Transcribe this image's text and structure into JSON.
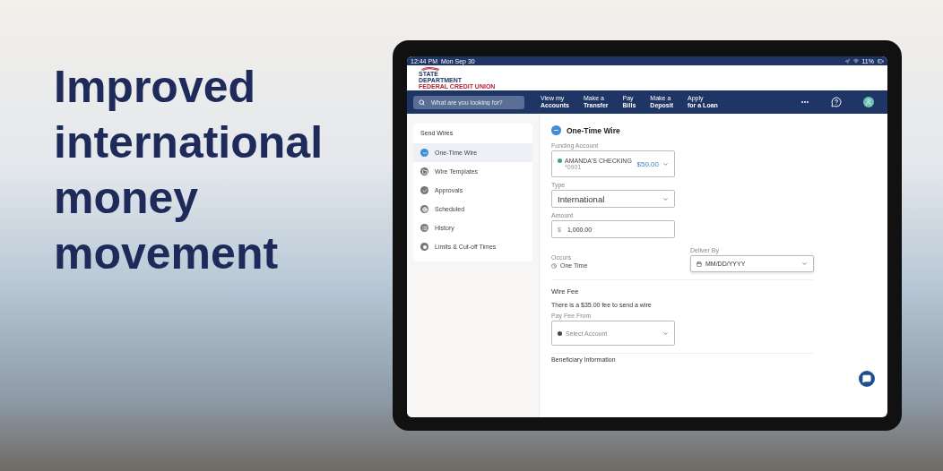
{
  "headline": [
    "Improved",
    "international",
    "money",
    "movement"
  ],
  "status_bar": {
    "time": "12:44 PM",
    "date": "Mon Sep 30",
    "battery": "11%"
  },
  "logo": {
    "lines": [
      "STATE",
      "DEPARTMENT",
      "FEDERAL CREDIT UNION"
    ]
  },
  "search": {
    "placeholder": "What are you looking for?"
  },
  "nav": [
    {
      "top": "View my",
      "bottom": "Accounts"
    },
    {
      "top": "Make a",
      "bottom": "Transfer"
    },
    {
      "top": "Pay",
      "bottom": "Bills"
    },
    {
      "top": "Make a",
      "bottom": "Deposit"
    },
    {
      "top": "Apply",
      "bottom": "for a Loan"
    }
  ],
  "sidebar": {
    "title": "Send Wires",
    "items": [
      {
        "label": "One-Time Wire",
        "selected": true,
        "kind": "minus"
      },
      {
        "label": "Wire Templates",
        "selected": false,
        "kind": "folder"
      },
      {
        "label": "Approvals",
        "selected": false,
        "kind": "check"
      },
      {
        "label": "Scheduled",
        "selected": false,
        "kind": "target"
      },
      {
        "label": "History",
        "selected": false,
        "kind": "list"
      },
      {
        "label": "Limits & Cut-off Times",
        "selected": false,
        "kind": "ring"
      }
    ]
  },
  "form": {
    "title": "One-Time Wire",
    "funding": {
      "label": "Funding Account",
      "name": "AMANDA'S CHECKING",
      "number": "*0901",
      "balance": "$50.00"
    },
    "type": {
      "label": "Type",
      "value": "International"
    },
    "amount": {
      "label": "Amount",
      "currency": "$",
      "value": "1,000.00"
    },
    "occurs": {
      "label": "Occurs",
      "value": "One Time"
    },
    "deliver_by": {
      "label": "Deliver By",
      "placeholder": "MM/DD/YYYY"
    },
    "wire_fee": {
      "heading": "Wire Fee",
      "text": "There is a $35.00 fee to send a wire",
      "label": "Pay Fee From",
      "placeholder": "Select Account"
    },
    "next_section": "Beneficiary Information"
  }
}
